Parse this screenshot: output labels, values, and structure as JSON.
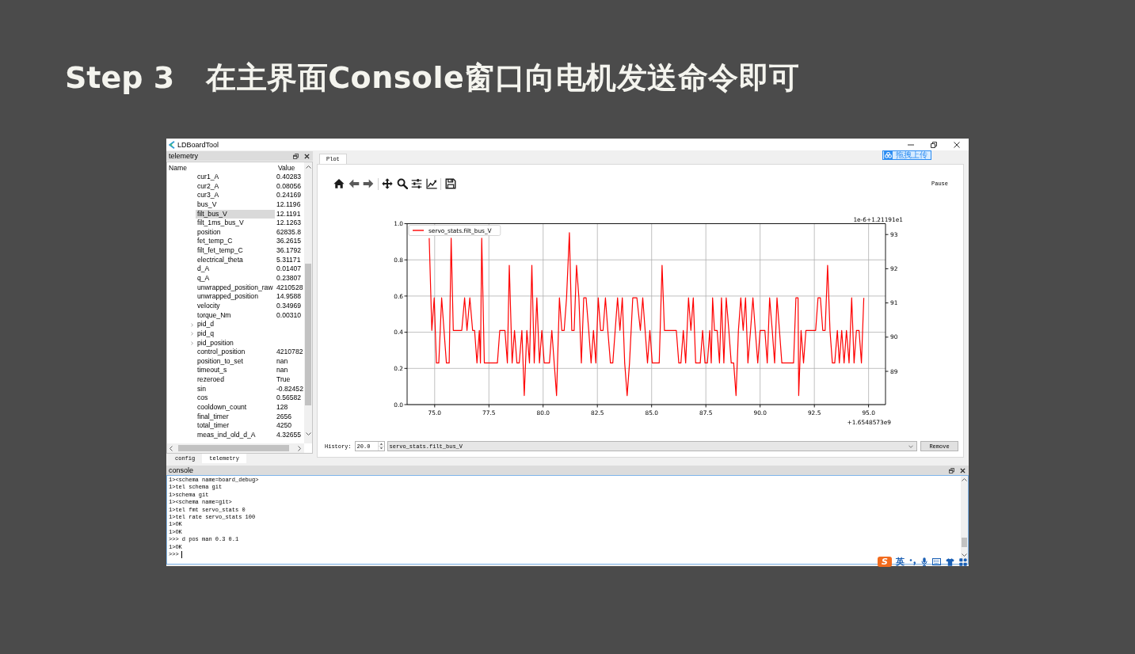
{
  "slide": {
    "step": "Step 3",
    "heading": "在主界面Console窗口向电机发送命令即可"
  },
  "window": {
    "title": "LDBoardTool"
  },
  "upload_widget": {
    "label": "拖拽上传"
  },
  "telemetry_panel": {
    "title": "telemetry",
    "columns": [
      "Name",
      "Value"
    ],
    "rows": [
      {
        "name": "cur1_A",
        "value": "0.40283",
        "kind": "leaf",
        "selected": false
      },
      {
        "name": "cur2_A",
        "value": "0.08056",
        "kind": "leaf",
        "selected": false
      },
      {
        "name": "cur3_A",
        "value": "0.24169",
        "kind": "leaf",
        "selected": false
      },
      {
        "name": "bus_V",
        "value": "12.1196",
        "kind": "leaf",
        "selected": false
      },
      {
        "name": "filt_bus_V",
        "value": "12.1191",
        "kind": "leaf",
        "selected": true
      },
      {
        "name": "filt_1ms_bus_V",
        "value": "12.1263",
        "kind": "leaf",
        "selected": false
      },
      {
        "name": "position",
        "value": "62835.8",
        "kind": "leaf",
        "selected": false
      },
      {
        "name": "fet_temp_C",
        "value": "36.2615",
        "kind": "leaf",
        "selected": false
      },
      {
        "name": "filt_fet_temp_C",
        "value": "36.1792",
        "kind": "leaf",
        "selected": false
      },
      {
        "name": "electrical_theta",
        "value": "5.31171",
        "kind": "leaf",
        "selected": false
      },
      {
        "name": "d_A",
        "value": "0.01407",
        "kind": "leaf",
        "selected": false
      },
      {
        "name": "q_A",
        "value": "0.23807",
        "kind": "leaf",
        "selected": false
      },
      {
        "name": "unwrapped_position_raw",
        "value": "4210528",
        "kind": "leaf",
        "selected": false
      },
      {
        "name": "unwrapped_position",
        "value": "14.9588",
        "kind": "leaf",
        "selected": false
      },
      {
        "name": "velocity",
        "value": "0.34969",
        "kind": "leaf",
        "selected": false
      },
      {
        "name": "torque_Nm",
        "value": "0.00310",
        "kind": "leaf",
        "selected": false
      },
      {
        "name": "pid_d",
        "kind": "group",
        "expanded": false,
        "selected": false
      },
      {
        "name": "pid_q",
        "kind": "group",
        "expanded": false,
        "selected": false
      },
      {
        "name": "pid_position",
        "kind": "group",
        "expanded": false,
        "selected": false
      },
      {
        "name": "control_position",
        "value": "4210782",
        "kind": "leaf",
        "selected": false
      },
      {
        "name": "position_to_set",
        "value": "nan",
        "kind": "leaf",
        "selected": false
      },
      {
        "name": "timeout_s",
        "value": "nan",
        "kind": "leaf",
        "selected": false
      },
      {
        "name": "rezeroed",
        "value": "True",
        "kind": "leaf",
        "selected": false
      },
      {
        "name": "sin",
        "value": "-0.82452",
        "kind": "leaf",
        "selected": false
      },
      {
        "name": "cos",
        "value": "0.56582",
        "kind": "leaf",
        "selected": false
      },
      {
        "name": "cooldown_count",
        "value": "128",
        "kind": "leaf",
        "selected": false
      },
      {
        "name": "final_timer",
        "value": "2656",
        "kind": "leaf",
        "selected": false
      },
      {
        "name": "total_timer",
        "value": "4250",
        "kind": "leaf",
        "selected": false
      },
      {
        "name": "meas_ind_old_d_A",
        "value": "4.32655",
        "kind": "leaf",
        "selected": false
      }
    ],
    "tabs": [
      {
        "label": "config",
        "selected": false
      },
      {
        "label": "telemetry",
        "selected": true
      }
    ]
  },
  "plot_panel": {
    "tabs": [
      {
        "label": "Plot",
        "selected": true
      }
    ],
    "pause_button": "Pause",
    "chart_data": {
      "type": "line",
      "x": [
        74.75,
        74.87,
        74.98,
        75.08,
        75.19,
        75.32,
        75.54,
        75.67,
        75.76,
        75.86,
        76.25,
        76.38,
        76.49,
        76.62,
        76.75,
        76.84,
        76.95,
        77.06,
        77.11,
        77.17,
        77.29,
        77.89,
        78.0,
        78.24,
        78.35,
        78.44,
        78.57,
        78.68,
        78.79,
        78.9,
        79.02,
        79.13,
        79.25,
        79.37,
        79.48,
        79.59,
        79.71,
        79.83,
        79.94,
        80.05,
        80.29,
        80.4,
        80.62,
        80.75,
        80.86,
        80.97,
        81.08,
        81.21,
        81.32,
        81.43,
        81.54,
        81.65,
        81.76,
        81.87,
        81.98,
        82.1,
        82.21,
        82.32,
        82.43,
        82.54,
        82.65,
        82.76,
        82.87,
        82.98,
        83.1,
        83.21,
        83.32,
        83.43,
        83.54,
        83.65,
        83.76,
        83.87,
        83.98,
        84.13,
        84.32,
        84.48,
        84.59,
        84.7,
        84.81,
        84.92,
        85.03,
        85.35,
        85.48,
        85.59,
        86.14,
        86.25,
        86.35,
        86.46,
        86.57,
        86.7,
        86.81,
        86.92,
        87.03,
        87.24,
        87.35,
        87.46,
        87.57,
        87.68,
        87.75,
        87.81,
        87.9,
        88.02,
        88.13,
        88.22,
        88.33,
        88.44,
        88.56,
        88.67,
        88.78,
        88.89,
        89.0,
        89.11,
        89.22,
        89.33,
        89.44,
        89.56,
        89.67,
        89.78,
        89.89,
        90.0,
        90.22,
        90.33,
        90.44,
        90.56,
        90.67,
        90.78,
        90.89,
        91.0,
        91.54,
        91.65,
        91.75,
        91.78,
        91.89,
        92.0,
        92.11,
        92.56,
        92.67,
        92.78,
        92.89,
        93.0,
        93.11,
        93.22,
        93.33,
        93.44,
        93.56,
        93.65,
        93.76,
        93.87,
        93.98,
        94.1,
        94.22,
        94.33,
        94.44,
        94.56,
        94.67,
        94.78
      ],
      "series": [
        {
          "name": "servo_stats.filt_bus_V",
          "color": "#ff0000",
          "values": [
            0.92,
            0.41,
            0.59,
            0.23,
            0.23,
            0.59,
            0.23,
            0.23,
            0.92,
            0.41,
            0.41,
            0.59,
            0.41,
            0.59,
            0.41,
            0.41,
            0.23,
            0.41,
            0.23,
            0.92,
            0.23,
            0.23,
            0.41,
            0.41,
            0.23,
            0.77,
            0.23,
            0.41,
            0.23,
            0.23,
            0.41,
            0.05,
            0.41,
            0.23,
            0.77,
            0.23,
            0.59,
            0.23,
            0.41,
            0.23,
            0.23,
            0.41,
            0.05,
            0.59,
            0.41,
            0.41,
            0.59,
            0.95,
            0.41,
            0.41,
            0.77,
            0.59,
            0.23,
            0.59,
            0.59,
            0.41,
            0.23,
            0.41,
            0.23,
            0.59,
            0.41,
            0.41,
            0.59,
            0.41,
            0.23,
            0.23,
            0.41,
            0.59,
            0.41,
            0.59,
            0.23,
            0.05,
            0.23,
            0.59,
            0.59,
            0.41,
            0.59,
            0.41,
            0.23,
            0.41,
            0.23,
            0.23,
            0.77,
            0.41,
            0.41,
            0.23,
            0.23,
            0.41,
            0.23,
            0.59,
            0.41,
            0.59,
            0.23,
            0.23,
            0.41,
            0.23,
            0.23,
            0.41,
            0.23,
            0.59,
            0.41,
            0.41,
            0.23,
            0.59,
            0.23,
            0.59,
            0.41,
            0.23,
            0.23,
            0.05,
            0.41,
            0.59,
            0.41,
            0.59,
            0.23,
            0.41,
            0.59,
            0.41,
            0.23,
            0.41,
            0.41,
            0.23,
            0.59,
            0.41,
            0.23,
            0.59,
            0.41,
            0.23,
            0.23,
            0.59,
            0.59,
            0.05,
            0.41,
            0.23,
            0.41,
            0.41,
            0.59,
            0.59,
            0.41,
            0.41,
            0.77,
            0.41,
            0.23,
            0.23,
            0.41,
            0.23,
            0.41,
            0.23,
            0.41,
            0.23,
            0.59,
            0.23,
            0.41,
            0.41,
            0.23,
            0.59
          ]
        }
      ],
      "xlim": [
        73.73,
        95.78
      ],
      "ylim": [
        0,
        1
      ],
      "xticks": [
        {
          "value": 75,
          "label": "75.0"
        },
        {
          "value": 77.5,
          "label": "77.5"
        },
        {
          "value": 80,
          "label": "80.0"
        },
        {
          "value": 82.5,
          "label": "82.5"
        },
        {
          "value": 85,
          "label": "85.0"
        },
        {
          "value": 87.5,
          "label": "87.5"
        },
        {
          "value": 90,
          "label": "90.0"
        },
        {
          "value": 92.5,
          "label": "92.5"
        },
        {
          "value": 95,
          "label": "95.0"
        }
      ],
      "yticks": [
        {
          "value": 0,
          "label": "0.0"
        },
        {
          "value": 0.2,
          "label": "0.2"
        },
        {
          "value": 0.4,
          "label": "0.4"
        },
        {
          "value": 0.6,
          "label": "0.6"
        },
        {
          "value": 0.8,
          "label": "0.8"
        },
        {
          "value": 1,
          "label": "1.0"
        }
      ],
      "grid": true,
      "annotations": [
        "1e-6+1.21191e1",
        "93",
        "92",
        "91",
        "90",
        "89",
        "+1.6548573e9"
      ]
    },
    "history": {
      "label": "History:",
      "value": "20.0"
    },
    "series_select": {
      "value": "servo_stats.filt_bus_V"
    },
    "remove_button": "Remove"
  },
  "console": {
    "title": "console",
    "lines": [
      "1><schema name=board_debug>",
      "1>tel schema git",
      "1>schema git",
      "1><schema name=git>",
      "1>tel fmt servo_stats 0",
      "1>tel rate servo_stats 100",
      "1>OK",
      "1>OK",
      ">>> d pos man 0.3 0.1",
      "1>OK"
    ],
    "prompt": ">>>"
  },
  "ime_bar": {
    "logo": "S",
    "language": "英"
  }
}
